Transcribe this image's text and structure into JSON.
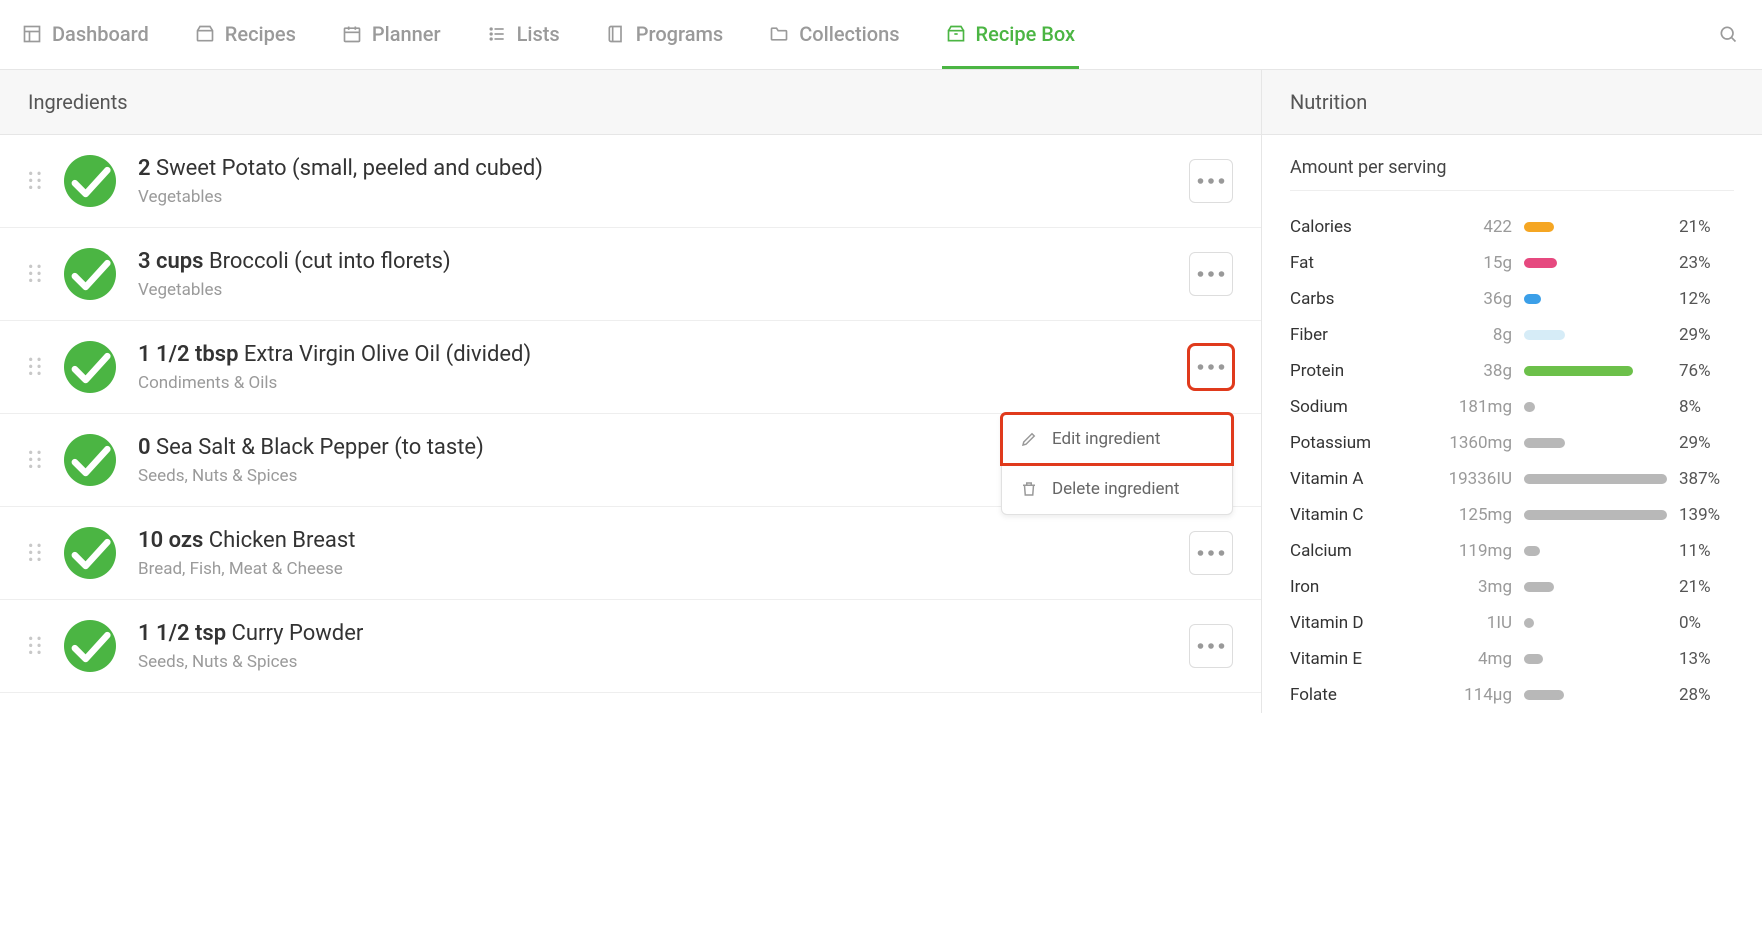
{
  "nav": {
    "items": [
      {
        "label": "Dashboard",
        "icon": "dashboard"
      },
      {
        "label": "Recipes",
        "icon": "inbox"
      },
      {
        "label": "Planner",
        "icon": "calendar"
      },
      {
        "label": "Lists",
        "icon": "list"
      },
      {
        "label": "Programs",
        "icon": "book"
      },
      {
        "label": "Collections",
        "icon": "folder"
      },
      {
        "label": "Recipe Box",
        "icon": "box",
        "active": true
      }
    ]
  },
  "ingredients_header": "Ingredients",
  "ingredients": [
    {
      "amount": "2",
      "name": "Sweet Potato (small, peeled and cubed)",
      "category": "Vegetables"
    },
    {
      "amount": "3 cups",
      "name": "Broccoli (cut into florets)",
      "category": "Vegetables"
    },
    {
      "amount": "1 1/2 tbsp",
      "name": "Extra Virgin Olive Oil (divided)",
      "category": "Condiments & Oils",
      "highlighted": true,
      "dropdown": true
    },
    {
      "amount": "0",
      "name": "Sea Salt & Black Pepper (to taste)",
      "category": "Seeds, Nuts & Spices"
    },
    {
      "amount": "10 ozs",
      "name": "Chicken Breast",
      "category": "Bread, Fish, Meat & Cheese"
    },
    {
      "amount": "1 1/2 tsp",
      "name": "Curry Powder",
      "category": "Seeds, Nuts & Spices"
    }
  ],
  "dropdown": {
    "edit": "Edit ingredient",
    "delete": "Delete ingredient"
  },
  "nutrition_header": "Nutrition",
  "amount_per_serving": "Amount per serving",
  "nutrition": [
    {
      "label": "Calories",
      "value": "422",
      "pct": "21%",
      "bar": 21,
      "color": "#f5a623"
    },
    {
      "label": "Fat",
      "value": "15g",
      "pct": "23%",
      "bar": 23,
      "color": "#e6497f"
    },
    {
      "label": "Carbs",
      "value": "36g",
      "pct": "12%",
      "bar": 12,
      "color": "#3b9fe8"
    },
    {
      "label": "Fiber",
      "value": "8g",
      "pct": "29%",
      "bar": 29,
      "color": "#d6ecf7"
    },
    {
      "label": "Protein",
      "value": "38g",
      "pct": "76%",
      "bar": 76,
      "color": "#6cc04a"
    },
    {
      "label": "Sodium",
      "value": "181mg",
      "pct": "8%",
      "bar": 8,
      "color": "#b8b8b8"
    },
    {
      "label": "Potassium",
      "value": "1360mg",
      "pct": "29%",
      "bar": 29,
      "color": "#b8b8b8"
    },
    {
      "label": "Vitamin A",
      "value": "19336IU",
      "pct": "387%",
      "bar": 100,
      "color": "#b8b8b8"
    },
    {
      "label": "Vitamin C",
      "value": "125mg",
      "pct": "139%",
      "bar": 100,
      "color": "#b8b8b8"
    },
    {
      "label": "Calcium",
      "value": "119mg",
      "pct": "11%",
      "bar": 11,
      "color": "#b8b8b8"
    },
    {
      "label": "Iron",
      "value": "3mg",
      "pct": "21%",
      "bar": 21,
      "color": "#b8b8b8"
    },
    {
      "label": "Vitamin D",
      "value": "1IU",
      "pct": "0%",
      "bar": 2,
      "color": "#b8b8b8"
    },
    {
      "label": "Vitamin E",
      "value": "4mg",
      "pct": "13%",
      "bar": 13,
      "color": "#b8b8b8"
    },
    {
      "label": "Folate",
      "value": "114µg",
      "pct": "28%",
      "bar": 28,
      "color": "#b8b8b8"
    }
  ]
}
